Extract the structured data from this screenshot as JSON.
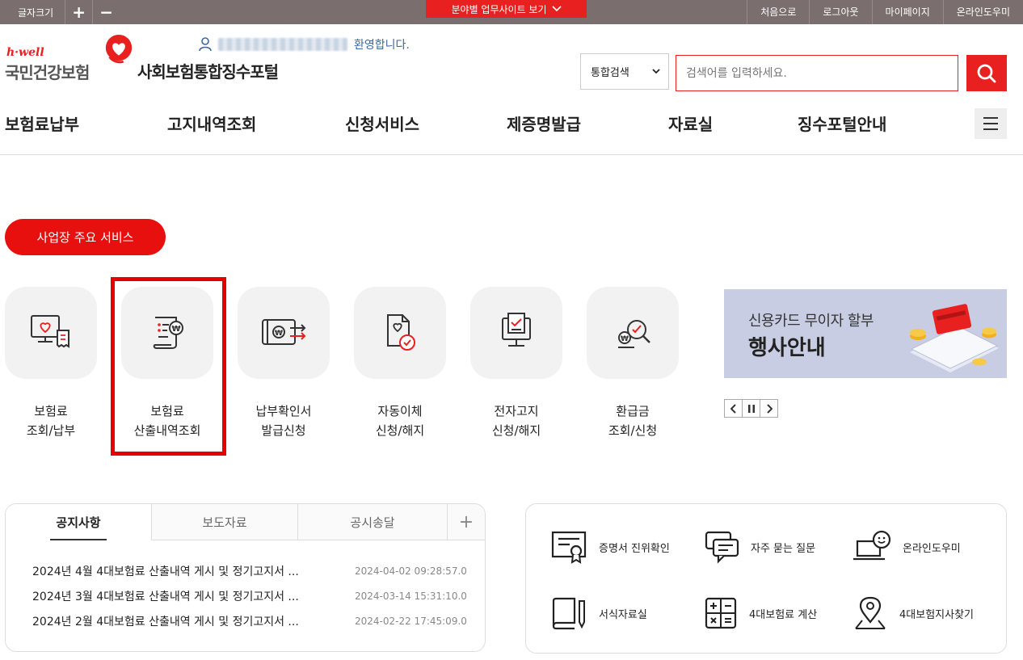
{
  "topbar": {
    "font_size_label": "글자크기",
    "font_plus": "+",
    "font_minus": "−",
    "site_button": "분야별 업무사이트 보기",
    "util_links": [
      "처음으로",
      "로그아웃",
      "마이페이지",
      "온라인도우미"
    ]
  },
  "header": {
    "logo_sub": "h·well",
    "logo_name": "국민건강보험",
    "portal_title": "사회보험통합징수포털",
    "welcome_text": "환영합니다.",
    "search_scope": "통합검색",
    "search_placeholder": "검색어를 입력하세요."
  },
  "gnb": [
    "보험료납부",
    "고지내역조회",
    "신청서비스",
    "제증명발급",
    "자료실",
    "징수포털안내"
  ],
  "main": {
    "section_button": "사업장 주요 서비스",
    "services": [
      {
        "line1": "보험료",
        "line2": "조회/납부",
        "icon": "monitor-receipt-icon"
      },
      {
        "line1": "보험료",
        "line2": "산출내역조회",
        "icon": "calculation-scroll-icon"
      },
      {
        "line1": "납부확인서",
        "line2": "발급신청",
        "icon": "payment-transfer-icon"
      },
      {
        "line1": "자동이체",
        "line2": "신청/해지",
        "icon": "auto-transfer-document-icon"
      },
      {
        "line1": "전자고지",
        "line2": "신청/해지",
        "icon": "electronic-notice-icon"
      },
      {
        "line1": "환급금",
        "line2": "조회/신청",
        "icon": "refund-search-icon"
      }
    ],
    "banner": {
      "line1": "신용카드 무이자 할부",
      "line2": "행사안내"
    }
  },
  "notice": {
    "tabs": [
      "공지사항",
      "보도자료",
      "공시송달"
    ],
    "plus": "+",
    "items": [
      {
        "title": "2024년 4월 4대보험료 산출내역 게시 및 정기고지서 ...",
        "date": "2024-04-02 09:28:57.0"
      },
      {
        "title": "2024년 3월 4대보험료 산출내역 게시 및 정기고지서 ...",
        "date": "2024-03-14 15:31:10.0"
      },
      {
        "title": "2024년 2월 4대보험료 산출내역 게시 및 정기고지서 ...",
        "date": "2024-02-22 17:45:09.0"
      }
    ]
  },
  "quick_links": [
    {
      "label": "증명서 진위확인",
      "icon": "certificate-icon"
    },
    {
      "label": "자주 묻는 질문",
      "icon": "chat-bubble-icon"
    },
    {
      "label": "온라인도우미",
      "icon": "helper-laptop-icon"
    },
    {
      "label": "서식자료실",
      "icon": "book-pencil-icon"
    },
    {
      "label": "4대보험료 계산",
      "icon": "calculator-icon"
    },
    {
      "label": "4대보험지사찾기",
      "icon": "location-pin-icon"
    }
  ],
  "colors": {
    "brand_red": "#e8201f",
    "topbar": "#7b6e6e",
    "highlight": "#e60000"
  }
}
